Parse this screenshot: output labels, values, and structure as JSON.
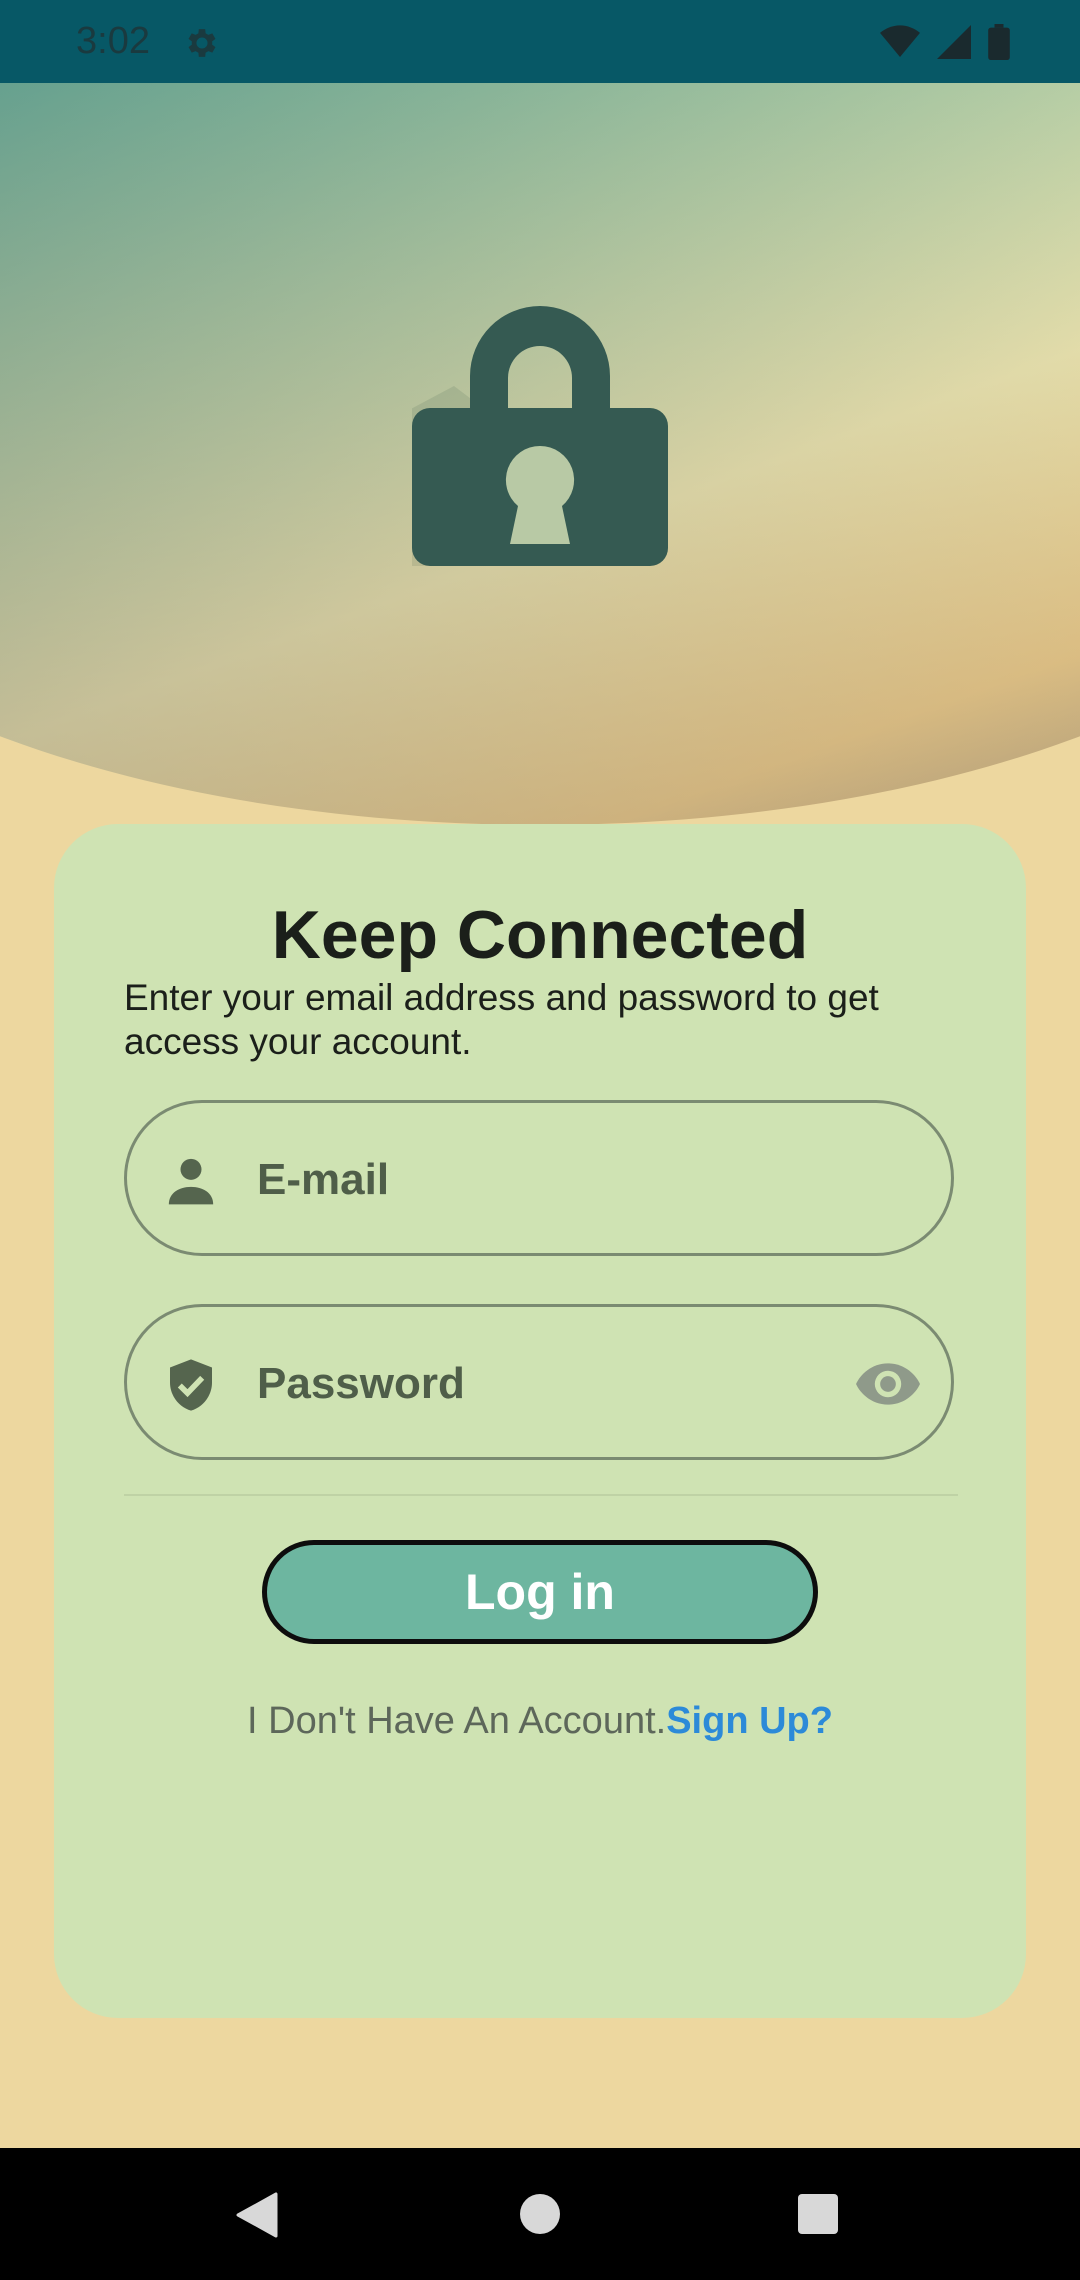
{
  "status_bar": {
    "time": "3:02",
    "icons": [
      "gear-icon",
      "wifi-icon",
      "signal-icon",
      "battery-icon"
    ]
  },
  "hero": {
    "icon": "lock-icon"
  },
  "login_card": {
    "title": "Keep Connected",
    "subtitle": "Enter your email address and password to get access your account.",
    "email_field": {
      "placeholder": "E-mail",
      "icon": "person-icon"
    },
    "password_field": {
      "placeholder": "Password",
      "icon": "shield-check-icon",
      "toggle_icon": "eye-icon"
    },
    "login_button": "Log in",
    "signup_prompt": "I Don't Have An Account.",
    "signup_link": "Sign Up?"
  },
  "nav_bar": {
    "buttons": [
      "back-icon",
      "home-icon",
      "recents-icon"
    ]
  },
  "colors": {
    "background": "#edd79f",
    "card": "#cfe3b3",
    "button": "#6db6a0",
    "link": "#2c8ad8",
    "lock": "#355a52"
  }
}
